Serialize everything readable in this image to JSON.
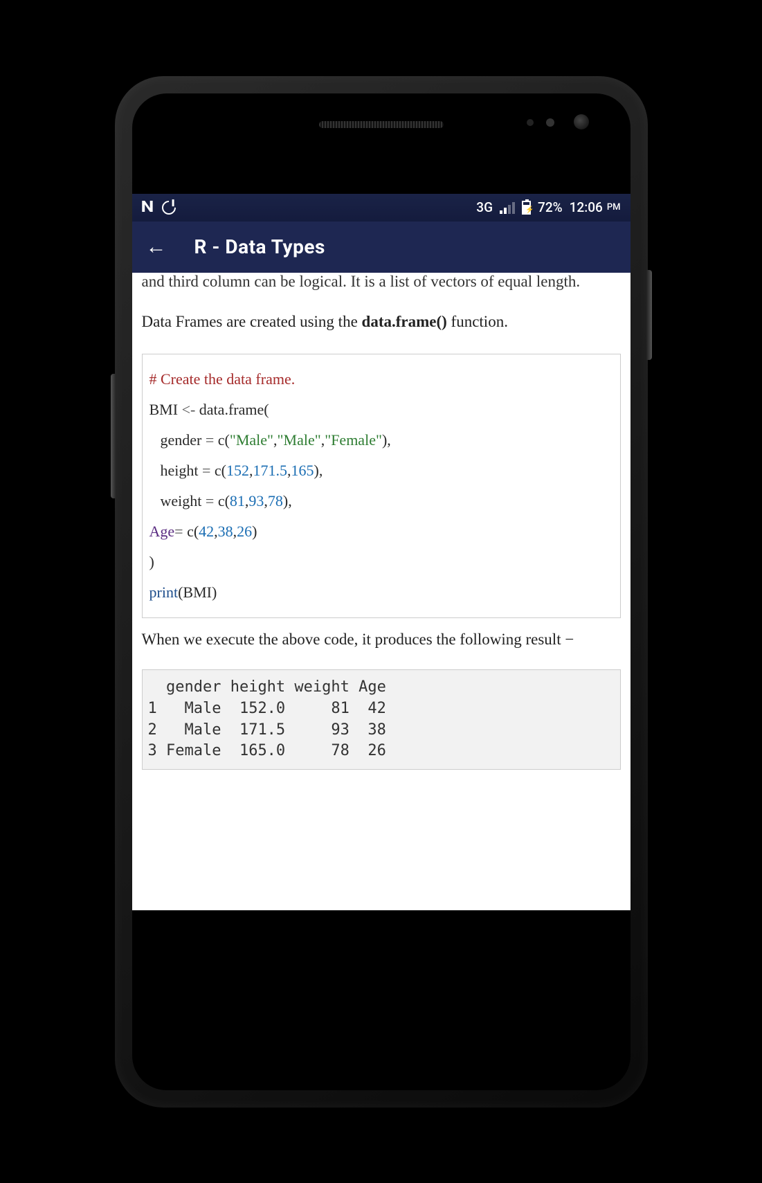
{
  "status": {
    "network": "3G",
    "battery_pct": "72%",
    "time": "12:06",
    "ampm": "PM"
  },
  "appbar": {
    "title": "R - Data Types"
  },
  "content": {
    "intro_cut": "and third column can be logical. It is a list of vectors of equal length.",
    "para1_pre": "Data Frames are created using the ",
    "para1_bold": "data.frame()",
    "para1_post": " function.",
    "code": {
      "comment": "# Create the data frame.",
      "l1a": "BMI ",
      "l1b": "<-",
      "l1c": "    data.frame(",
      "l2a": "gender ",
      "l2b": "=",
      "l2c": " c(",
      "l2d": "\"Male\"",
      "l2e": ",",
      "l2f": "\"Male\"",
      "l2g": ",",
      "l2h": "\"Female\"",
      "l2i": "),",
      "l3a": "height ",
      "l3b": "=",
      "l3c": " c(",
      "l3d": "152",
      "l3e": ",",
      "l3f": "171.5",
      "l3g": ",",
      "l3h": "165",
      "l3i": "),",
      "l4a": "weight ",
      "l4b": "=",
      "l4c": " c(",
      "l4d": "81",
      "l4e": ",",
      "l4f": "93",
      "l4g": ",",
      "l4h": "78",
      "l4i": "),",
      "l5a": "Age",
      "l5b": "=",
      "l5c": " c(",
      "l5d": "42",
      "l5e": ",",
      "l5f": "38",
      "l5g": ",",
      "l5h": "26",
      "l5i": ")",
      "l6": ")",
      "l7a": "print",
      "l7b": "(BMI)"
    },
    "result_text": "When we execute the above code, it produces the following result −",
    "output": "  gender height weight Age\n1   Male  152.0     81  42\n2   Male  171.5     93  38\n3 Female  165.0     78  26"
  }
}
